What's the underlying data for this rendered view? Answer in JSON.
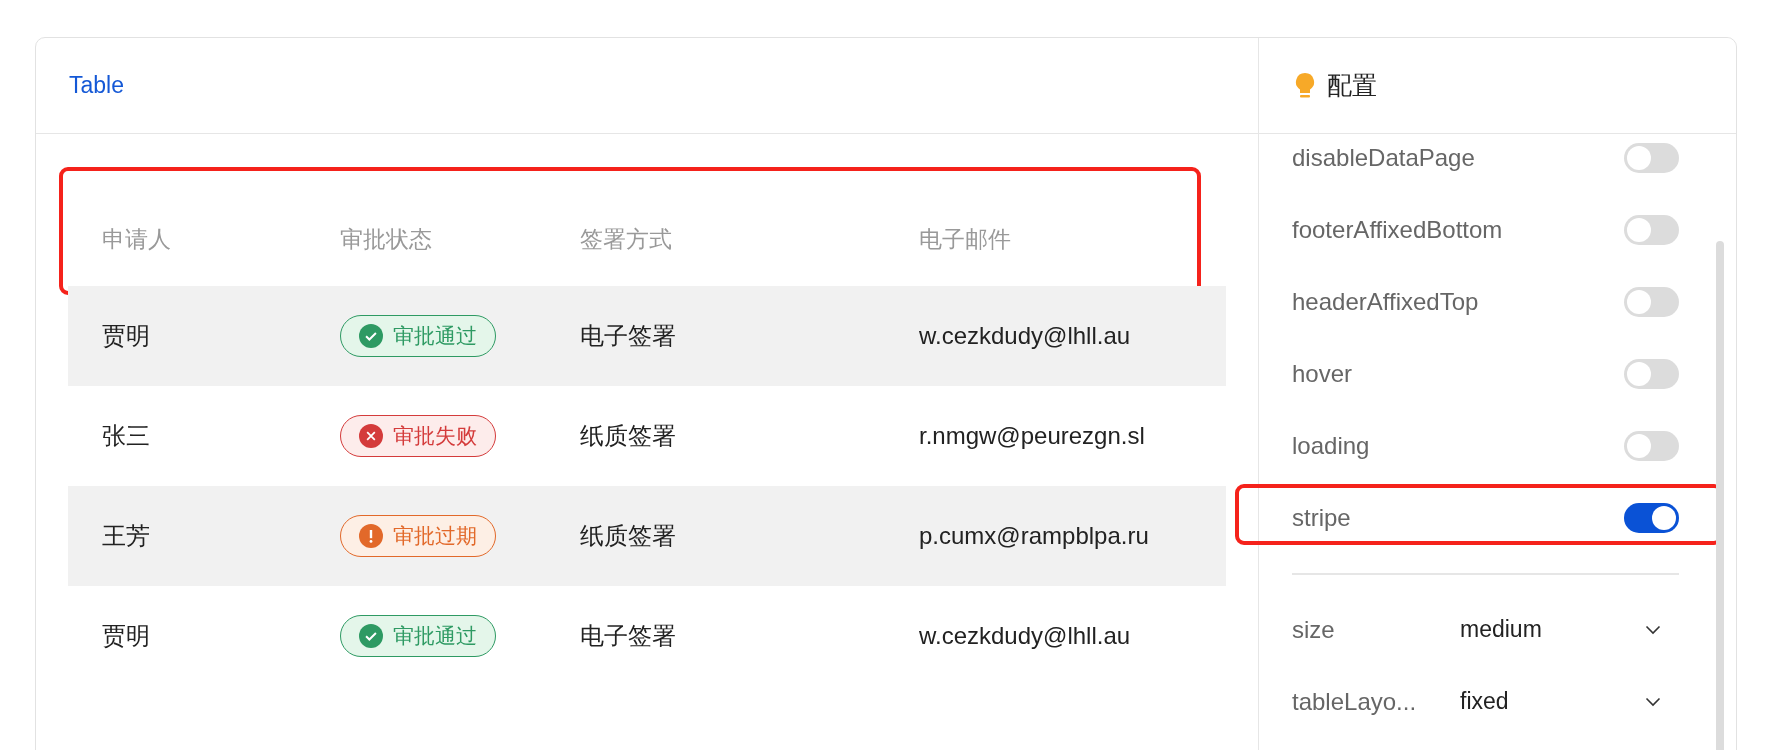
{
  "title": "Table",
  "table": {
    "striped": true,
    "header_highlighted": true,
    "columns": [
      "申请人",
      "审批状态",
      "签署方式",
      "电子邮件"
    ],
    "rows": [
      {
        "applicant": "贾明",
        "status": {
          "kind": "success",
          "label": "审批通过"
        },
        "signing": "电子签署",
        "email": "w.cezkdudy@lhll.au"
      },
      {
        "applicant": "张三",
        "status": {
          "kind": "error",
          "label": "审批失败"
        },
        "signing": "纸质签署",
        "email": "r.nmgw@peurezgn.sl"
      },
      {
        "applicant": "王芳",
        "status": {
          "kind": "warning",
          "label": "审批过期"
        },
        "signing": "纸质签署",
        "email": "p.cumx@rampblpa.ru"
      },
      {
        "applicant": "贾明",
        "status": {
          "kind": "success",
          "label": "审批通过"
        },
        "signing": "电子签署",
        "email": "w.cezkdudy@lhll.au"
      }
    ]
  },
  "config": {
    "title": "配置",
    "switches": [
      {
        "label": "disableDataPage",
        "on": false,
        "highlighted": false
      },
      {
        "label": "footerAffixedBottom",
        "on": false,
        "highlighted": false
      },
      {
        "label": "headerAffixedTop",
        "on": false,
        "highlighted": false
      },
      {
        "label": "hover",
        "on": false,
        "highlighted": false
      },
      {
        "label": "loading",
        "on": false,
        "highlighted": false
      },
      {
        "label": "stripe",
        "on": true,
        "highlighted": true
      }
    ],
    "selects": [
      {
        "label": "size",
        "value": "medium"
      },
      {
        "label": "tableLayo...",
        "value": "fixed"
      }
    ]
  }
}
